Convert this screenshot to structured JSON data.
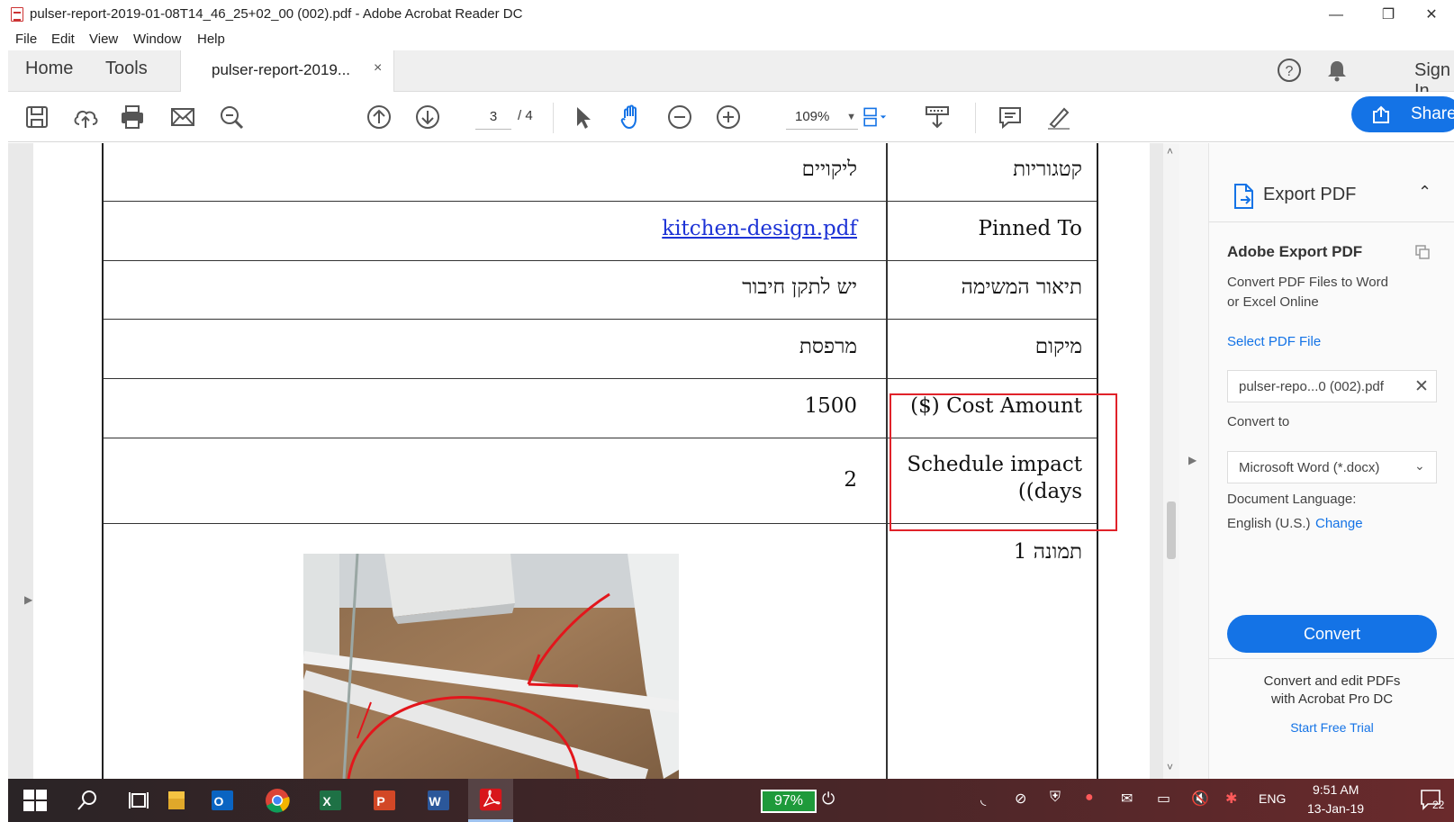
{
  "window": {
    "title": "pulser-report-2019-01-08T14_46_25+02_00 (002).pdf - Adobe Acrobat Reader DC",
    "controls": {
      "minimize": "—",
      "restore": "❐",
      "close": "✕"
    }
  },
  "menu": [
    "File",
    "Edit",
    "View",
    "Window",
    "Help"
  ],
  "tabs": {
    "home": "Home",
    "tools": "Tools",
    "document": "pulser-report-2019...",
    "close": "×",
    "sign_in": "Sign In"
  },
  "toolbar": {
    "current_page": "3",
    "total_pages": "/ 4",
    "zoom": "109%",
    "share_label": "Share"
  },
  "document": {
    "rows": [
      {
        "label": "קטגוריות",
        "value": "ליקויים"
      },
      {
        "label": "Pinned To",
        "value": "kitchen-design.pdf"
      },
      {
        "label": "תיאור המשימה",
        "value": "יש לתקן חיבור"
      },
      {
        "label": "מיקום",
        "value": "מרפסת"
      },
      {
        "label": "($) Cost Amount",
        "value": "1500"
      },
      {
        "label": "Schedule impact",
        "label_line2": "((days",
        "value": "2"
      },
      {
        "label": "תמונה 1",
        "value": ""
      }
    ]
  },
  "export_panel": {
    "header": "Export PDF",
    "title": "Adobe Export PDF",
    "description_line1": "Convert PDF Files to Word",
    "description_line2": "or Excel Online",
    "select_file": "Select PDF File",
    "file_name": "pulser-repo...0 (002).pdf",
    "convert_to_label": "Convert to",
    "convert_to_value": "Microsoft Word (*.docx)",
    "doc_language_label": "Document Language:",
    "doc_language_value": "English (U.S.)",
    "change_label": "Change",
    "convert_button": "Convert",
    "promo_line1": "Convert and edit PDFs",
    "promo_line2": "with Acrobat Pro DC",
    "trial_link": "Start Free Trial"
  },
  "taskbar": {
    "battery": "97%",
    "language": "ENG",
    "time": "9:51 AM",
    "date": "13-Jan-19",
    "notifications": "22"
  },
  "colors": {
    "accent_blue": "#1473e6",
    "annotation_red": "#e0222a",
    "link_blue": "#1d33d6"
  }
}
